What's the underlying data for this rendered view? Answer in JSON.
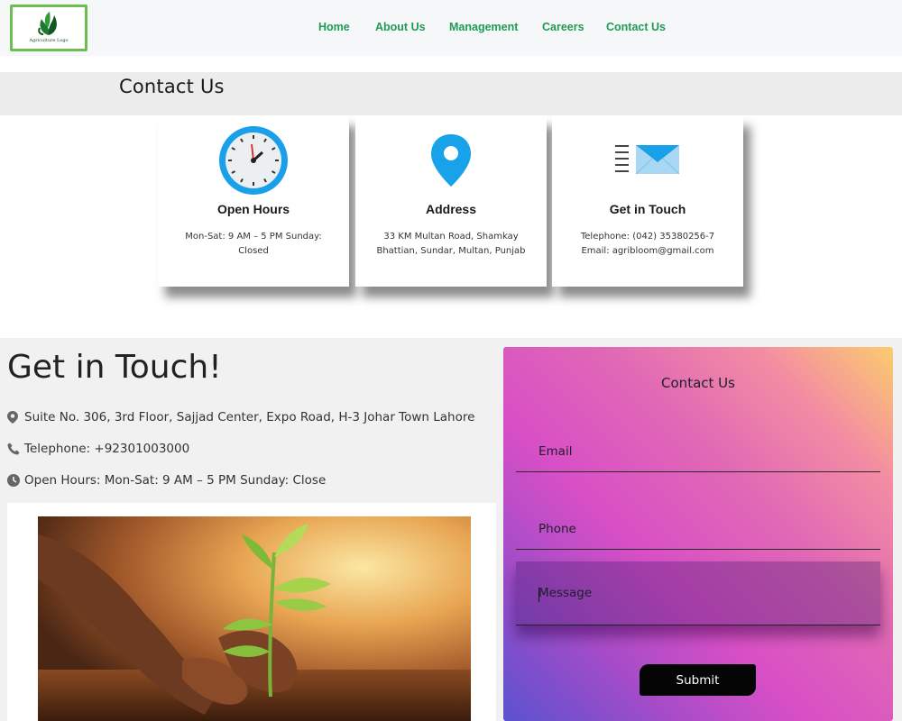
{
  "header": {
    "logo_text": "Agriculture Logo",
    "nav": [
      {
        "label": "Home"
      },
      {
        "label": "About Us"
      },
      {
        "label": "Management"
      },
      {
        "label": "Careers"
      },
      {
        "label": "Contact Us"
      }
    ]
  },
  "page_title": "Contact Us",
  "cards": [
    {
      "icon": "clock-icon",
      "title": "Open Hours",
      "text": "Mon-Sat: 9 AM – 5 PM Sunday: Closed"
    },
    {
      "icon": "location-pin-icon",
      "title": "Address",
      "text": "33 KM Multan Road, Shamkay Bhattian, Sundar, Multan, Punjab"
    },
    {
      "icon": "envelope-icon",
      "title": "Get in Touch",
      "text_lines": [
        "Telephone: (042) 35380256-7",
        "Email: agribloom@gmail.com"
      ]
    }
  ],
  "get_in_touch": {
    "title": "Get in Touch!",
    "address": "Suite No. 306, 3rd Floor, Sajjad Center, Expo Road, H-3 Johar Town Lahore",
    "telephone": "Telephone: +92301003000",
    "hours": "Open Hours: Mon-Sat: 9 AM – 5 PM Sunday: Close"
  },
  "form": {
    "title": "Contact Us",
    "email_label": "Email",
    "phone_label": "Phone",
    "message_label": "Message",
    "submit_label": "Submit"
  },
  "colors": {
    "nav": "#1e9b55",
    "logo_border": "#6cbf4e",
    "form_gradient": [
      "#fbcc6e",
      "#e068b5",
      "#d84fc6",
      "#5b51cf"
    ],
    "submit_bg": "#050505"
  }
}
